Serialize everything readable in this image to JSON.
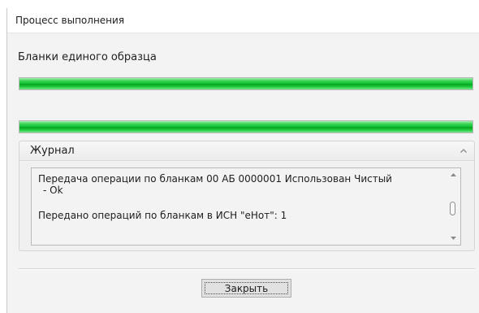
{
  "window": {
    "title": "Процесс выполнения"
  },
  "section": {
    "label": "Бланки единого образца"
  },
  "progress_bars": [
    {
      "name": "forms-progress",
      "fill_fraction": 1.0
    },
    {
      "name": "overall-progress",
      "fill_fraction": 1.0
    }
  ],
  "journal": {
    "title": "Журнал",
    "collapse_icon": "chevron-up-icon",
    "lines": [
      "Передача операции по бланкам 00 АБ 0000001 Использован Чистый",
      "- Ok",
      "Передано операций по бланкам в ИСН \"еНот\": 1"
    ],
    "scroll_position_fraction": 0.55
  },
  "footer": {
    "close_label": "Закрыть"
  },
  "colors": {
    "progress_green": "#0cc02f",
    "panel_background": "#f3f3f3",
    "title_background": "#ffffff"
  }
}
